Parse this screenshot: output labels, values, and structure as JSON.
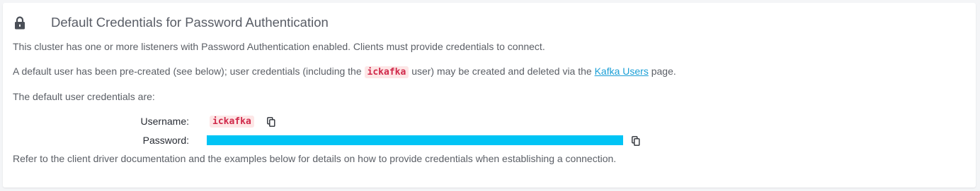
{
  "section": {
    "title": "Default Credentials for Password Authentication",
    "icon": "lock-icon"
  },
  "paragraphs": {
    "intro": "This cluster has one or more listeners with Password Authentication enabled. Clients must provide credentials to connect.",
    "default_user_prefix": "A default user has been pre-created (see below); user credentials (including the ",
    "default_user_code": "ickafka",
    "default_user_middle": " user) may be created and deleted via the ",
    "kafka_users_link": "Kafka Users",
    "default_user_suffix": " page.",
    "credentials_intro": "The default user credentials are:",
    "refer": "Refer to the client driver documentation and the examples below for details on how to provide credentials when establishing a connection."
  },
  "credentials": {
    "username_label": "Username:",
    "username_value": "ickafka",
    "password_label": "Password:",
    "password_state": "redacted"
  },
  "colors": {
    "accent": "#00c4f5",
    "code_text": "#d0294a",
    "code_bg": "#fde6e6",
    "link": "#1b9fd6"
  }
}
